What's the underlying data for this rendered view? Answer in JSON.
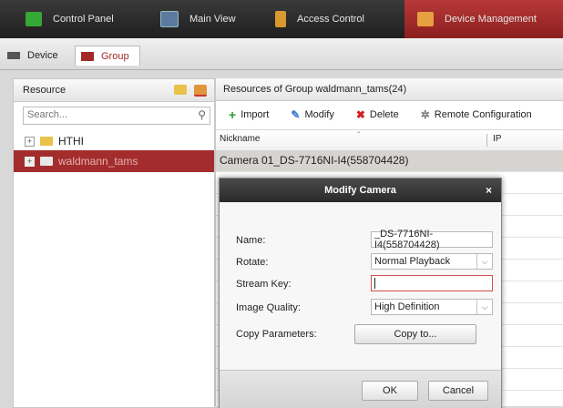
{
  "top_tabs": [
    {
      "label": "Control Panel",
      "icon": "grid-icon",
      "color": "#36a836"
    },
    {
      "label": "Main View",
      "icon": "monitor-icon",
      "color": "#5a7aa0"
    },
    {
      "label": "Access Control",
      "icon": "door-icon",
      "color": "#d89a30"
    },
    {
      "label": "Device Management",
      "icon": "device-icon",
      "color": "#e6a040"
    }
  ],
  "sub_tabs": [
    {
      "label": "Device"
    },
    {
      "label": "Group"
    }
  ],
  "resource": {
    "title": "Resource",
    "search_placeholder": "Search...",
    "tree": [
      {
        "label": "HTHI",
        "expander": "+"
      },
      {
        "label": "waldmann_tams",
        "expander": "+"
      }
    ]
  },
  "group_panel": {
    "title": "Resources of Group waldmann_tams(24)",
    "toolbar": [
      {
        "label": "Import",
        "glyph": "+",
        "color": "#2f9a2f"
      },
      {
        "label": "Modify",
        "glyph": "✎",
        "color": "#3d7bd0"
      },
      {
        "label": "Delete",
        "glyph": "✖",
        "color": "#d02020"
      },
      {
        "label": "Remote Configuration",
        "glyph": "✲",
        "color": "#777777"
      }
    ],
    "columns": [
      "Nickname",
      "IP"
    ],
    "sort_glyph": "ˆ",
    "selected_row": "Camera 01_DS-7716NI-I4(558704428)"
  },
  "dialog": {
    "title": "Modify Camera",
    "close_glyph": "×",
    "fields": {
      "name_label": "Name:",
      "name_value": "_DS-7716NI-I4(558704428)",
      "rotate_label": "Rotate:",
      "rotate_value": "Normal Playback",
      "stream_key_label": "Stream Key:",
      "stream_key_value": "",
      "quality_label": "Image Quality:",
      "quality_value": "High Definition",
      "copy_label": "Copy Parameters:",
      "copy_button": "Copy to..."
    },
    "dropdown_glyph": "⌵",
    "ok_label": "OK",
    "cancel_label": "Cancel"
  },
  "colors": {
    "accent": "#a32828",
    "selection": "#a32d2d",
    "stream_key_border": "#d24d4d"
  }
}
